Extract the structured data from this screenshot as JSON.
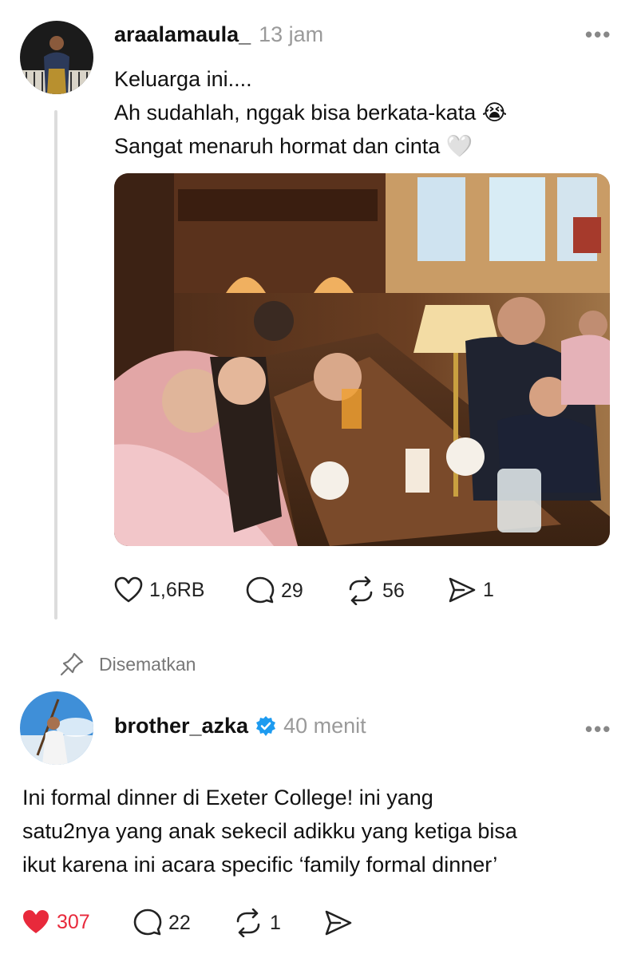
{
  "post": {
    "username": "araalamaula_",
    "time": "13 jam",
    "lines": [
      "Keluarga ini....",
      "Ah sudahlah, nggak bisa berkata-kata 😭",
      "Sangat menaruh hormat dan cinta 🤍"
    ],
    "actions": {
      "likes": "1,6RB",
      "comments": "29",
      "reposts": "56",
      "shares": "1"
    }
  },
  "pinned_label": "Disematkan",
  "reply": {
    "username": "brother_azka",
    "time": "40 menit",
    "lines": [
      "Ini formal dinner di Exeter College! ini yang",
      "satu2nya yang anak sekecil adikku yang ketiga bisa",
      "ikut karena ini acara specific ‘family formal dinner’"
    ],
    "actions": {
      "likes": "307",
      "comments": "22",
      "reposts": "1"
    },
    "liked_color": "#e8293b",
    "verified_color": "#1d9bf0"
  },
  "icons": [
    "more-icon",
    "heart-icon",
    "comment-icon",
    "repost-icon",
    "share-icon",
    "pin-icon",
    "verified-icon"
  ]
}
